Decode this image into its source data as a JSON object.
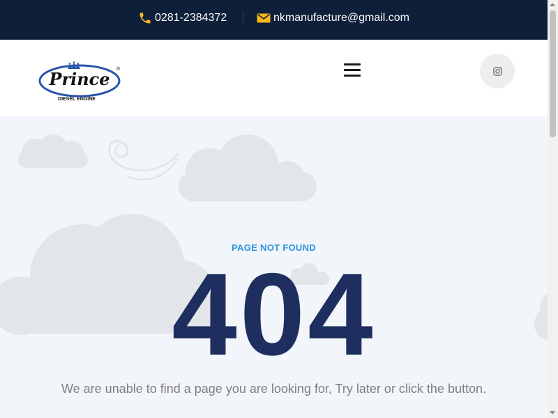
{
  "topbar": {
    "phone": "0281-2384372",
    "email": "nkmanufacture@gmail.com",
    "phone_icon": "phone-icon",
    "email_icon": "envelope-icon",
    "icon_color": "#f5b71c",
    "background": "#0e1f3a"
  },
  "header": {
    "logo": {
      "brand": "Prince",
      "tagline": "DIESEL ENGINE",
      "mark": "®"
    },
    "menu_icon": "hamburger-menu-icon",
    "social_icon": "instagram-icon"
  },
  "error": {
    "eyebrow": "PAGE NOT FOUND",
    "code": "404",
    "message": "We are unable to find a page you are looking for, Try later or click the button."
  },
  "colors": {
    "accent": "#2c95e2",
    "code": "#1e2e5e",
    "page_bg": "#f2f5f9",
    "cloud": "#e2e5ea"
  }
}
